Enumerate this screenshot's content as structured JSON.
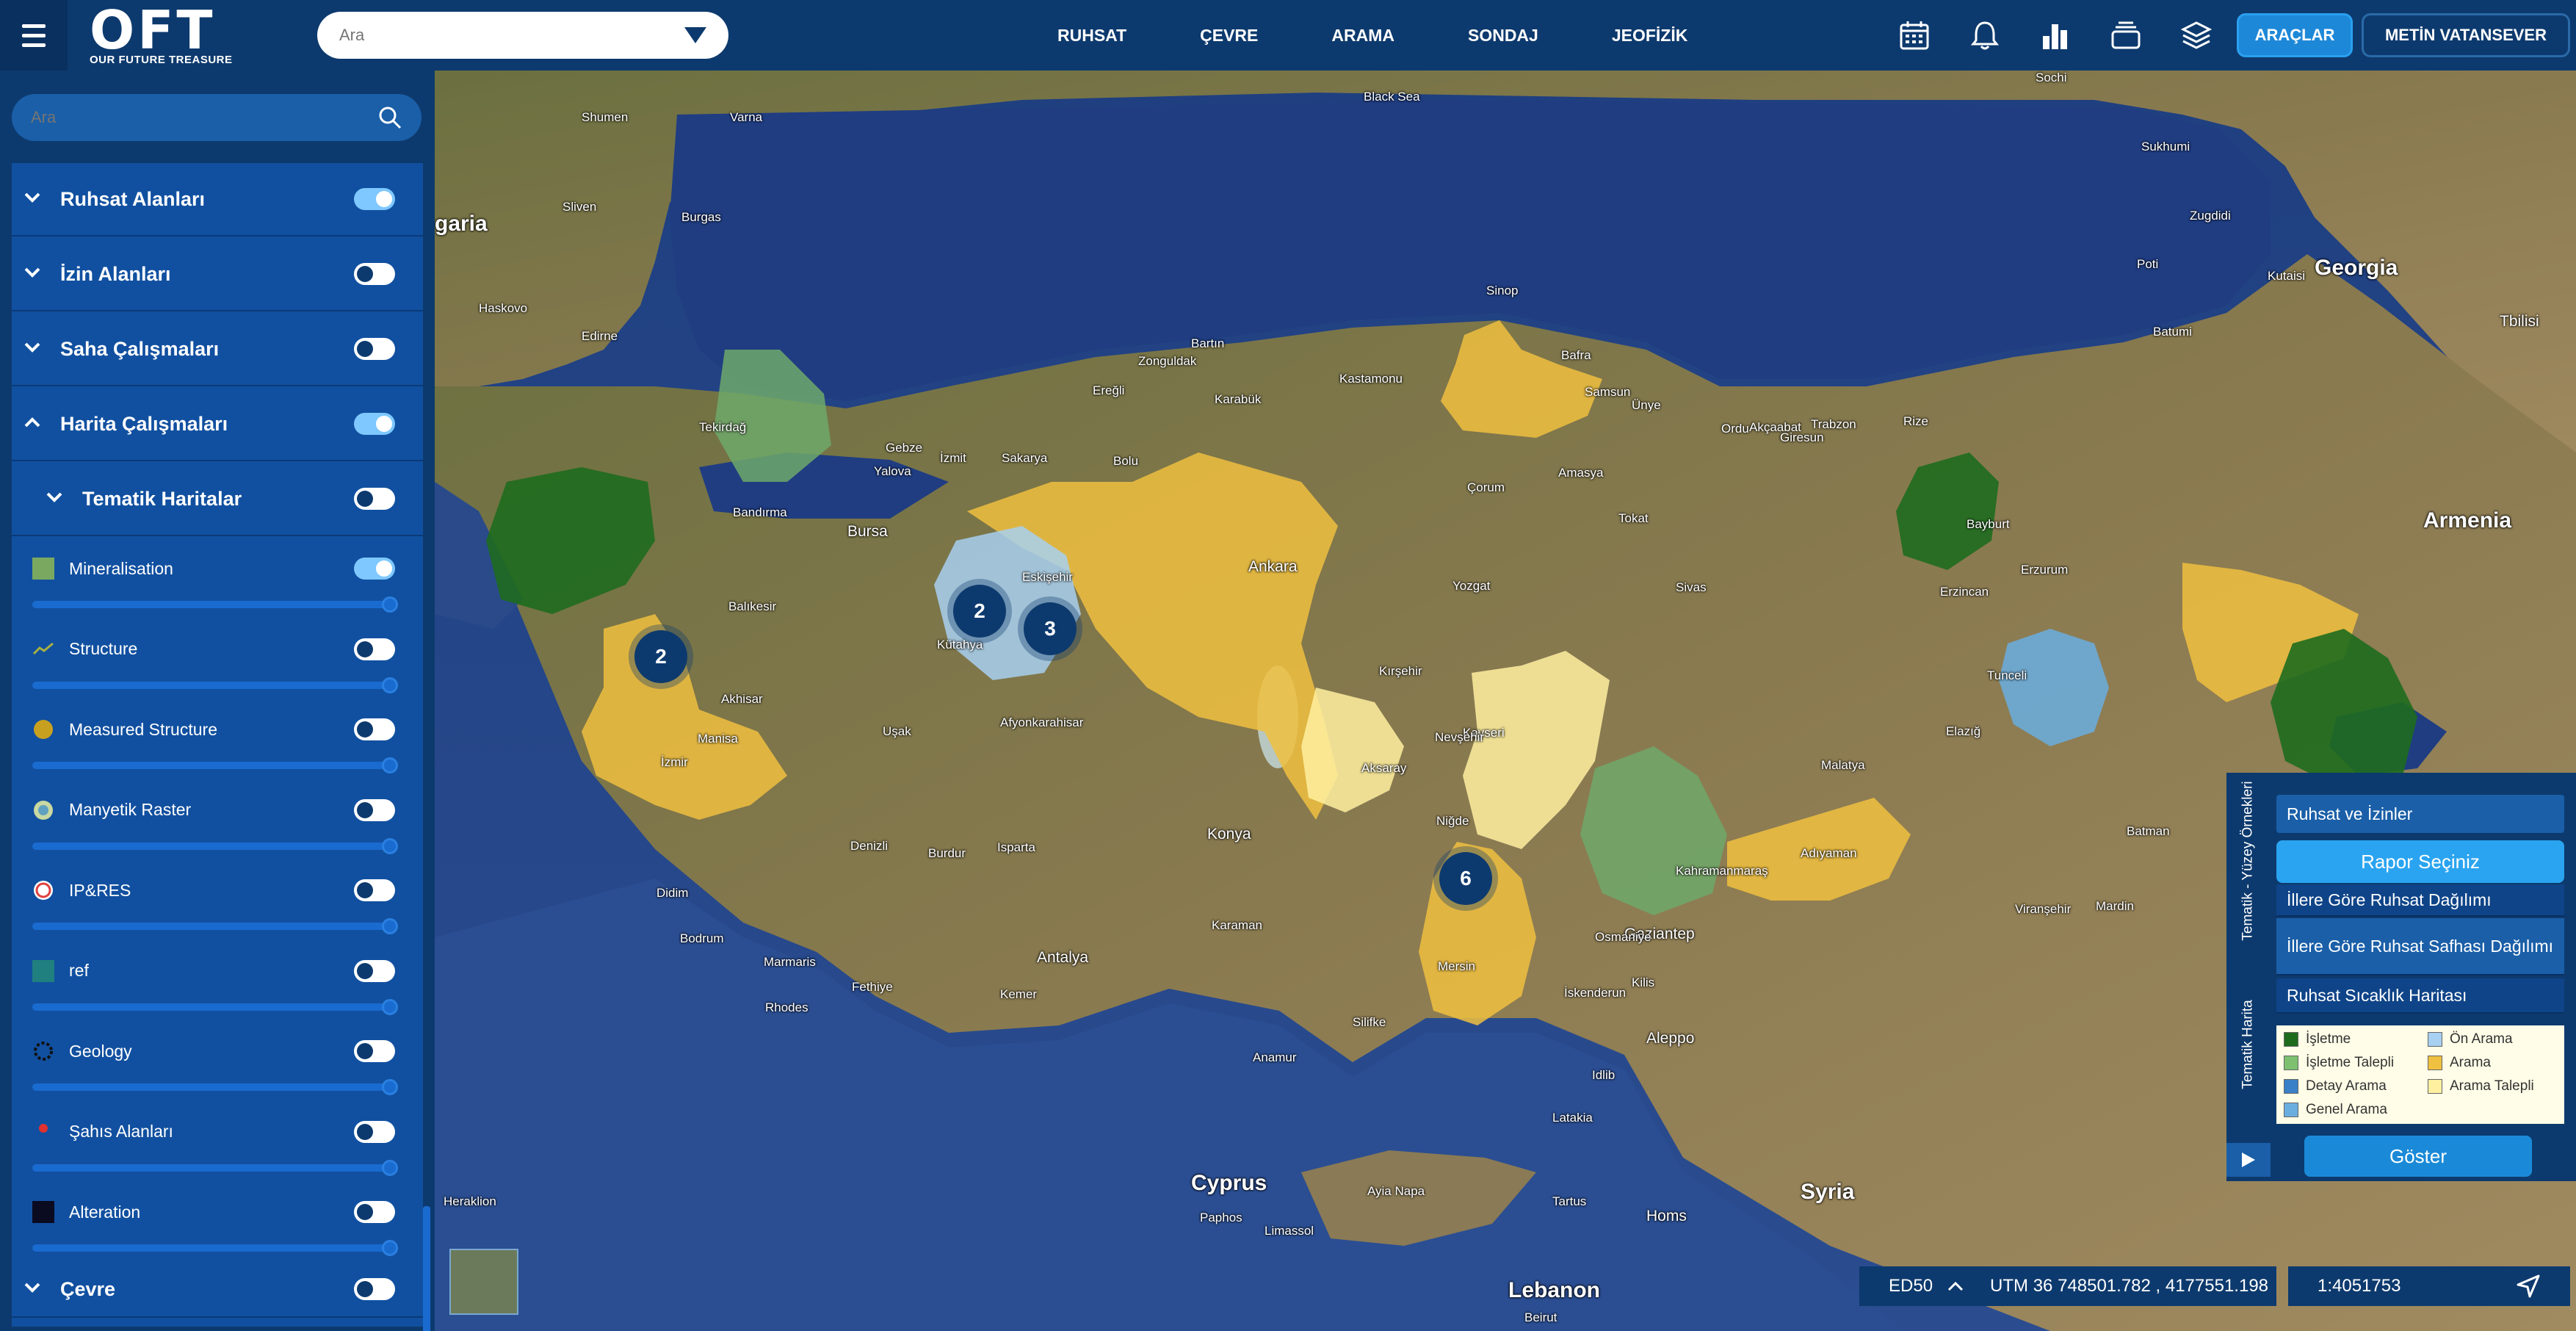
{
  "header": {
    "logo_text": "OFT",
    "logo_subtitle": "OUR FUTURE TREASURE",
    "search_placeholder": "Ara",
    "nav": [
      "RUHSAT",
      "ÇEVRE",
      "ARAMA",
      "SONDAJ",
      "JEOFİZİK"
    ],
    "icons": [
      "calendar-icon",
      "bell-icon",
      "bar-chart-icon",
      "stack-icon",
      "layers-icon"
    ],
    "araclar_label": "ARAÇLAR",
    "user_label": "METİN VATANSEVER"
  },
  "sidebar": {
    "search_placeholder": "Ara",
    "groups": [
      {
        "label": "Ruhsat Alanları",
        "toggle": "on"
      },
      {
        "label": "İzin Alanları",
        "toggle": "off"
      },
      {
        "label": "Saha Çalışmaları",
        "toggle": "off"
      },
      {
        "label": "Harita Çalışmaları",
        "toggle": "on"
      },
      {
        "label": "Tematik Haritalar",
        "toggle": "off"
      },
      {
        "label": "Çevre",
        "toggle": "off"
      }
    ],
    "layers": [
      {
        "label": "Mineralisation",
        "toggle": "on",
        "icon": "mineralisation-icon",
        "color": "#7aa860"
      },
      {
        "label": "Structure",
        "toggle": "off",
        "icon": "structure-line-icon",
        "color": "#a8b040"
      },
      {
        "label": "Measured Structure",
        "toggle": "off",
        "icon": "measured-structure-icon",
        "color": "#c8a020"
      },
      {
        "label": "Manyetik Raster",
        "toggle": "off",
        "icon": "raster-icon",
        "color": "#60a0c0"
      },
      {
        "label": "IP&RES",
        "toggle": "off",
        "icon": "ip-res-icon",
        "color": "#e04040"
      },
      {
        "label": "ref",
        "toggle": "off",
        "icon": "ref-icon",
        "color": "#208080"
      },
      {
        "label": "Geology",
        "toggle": "off",
        "icon": "geology-icon",
        "color": "#111111"
      },
      {
        "label": "Şahıs Alanları",
        "toggle": "off",
        "icon": "pin-icon",
        "color": "#e03030"
      },
      {
        "label": "Alteration",
        "toggle": "off",
        "icon": "alteration-icon",
        "color": "#0a0a20"
      }
    ]
  },
  "map": {
    "labels": [
      {
        "text": "Black Sea",
        "cls": ""
      },
      {
        "text": "Georgia",
        "cls": "big"
      },
      {
        "text": "Armenia",
        "cls": "big"
      },
      {
        "text": "Tbilisi",
        "cls": "mid"
      },
      {
        "text": "Syria",
        "cls": "big"
      },
      {
        "text": "Cyprus",
        "cls": "big"
      },
      {
        "text": "Lebanon",
        "cls": "big"
      },
      {
        "text": "garia",
        "cls": "big"
      },
      {
        "text": "Bursa",
        "cls": "mid"
      },
      {
        "text": "Ankara",
        "cls": "mid"
      },
      {
        "text": "Konya",
        "cls": "mid"
      },
      {
        "text": "Antalya",
        "cls": "mid"
      },
      {
        "text": "Gaziantep",
        "cls": "mid"
      },
      {
        "text": "Aleppo",
        "cls": "mid"
      },
      {
        "text": "Homs",
        "cls": "mid"
      },
      {
        "text": "Samsun",
        "cls": ""
      },
      {
        "text": "Trabzon",
        "cls": ""
      },
      {
        "text": "Erzurum",
        "cls": ""
      },
      {
        "text": "Sivas",
        "cls": ""
      },
      {
        "text": "Kayseri",
        "cls": ""
      },
      {
        "text": "Malatya",
        "cls": ""
      },
      {
        "text": "Elazığ",
        "cls": ""
      },
      {
        "text": "Mardin",
        "cls": ""
      },
      {
        "text": "Batman",
        "cls": ""
      },
      {
        "text": "Zonguldak",
        "cls": ""
      },
      {
        "text": "Karabük",
        "cls": ""
      },
      {
        "text": "Kastamonu",
        "cls": ""
      },
      {
        "text": "Sinop",
        "cls": ""
      },
      {
        "text": "Bolu",
        "cls": ""
      },
      {
        "text": "Çorum",
        "cls": ""
      },
      {
        "text": "Amasya",
        "cls": ""
      },
      {
        "text": "Tokat",
        "cls": ""
      },
      {
        "text": "Ordu",
        "cls": ""
      },
      {
        "text": "Giresun",
        "cls": ""
      },
      {
        "text": "Rize",
        "cls": ""
      },
      {
        "text": "Bayburt",
        "cls": ""
      },
      {
        "text": "Erzincan",
        "cls": ""
      },
      {
        "text": "Tunceli",
        "cls": ""
      },
      {
        "text": "Kırşehir",
        "cls": ""
      },
      {
        "text": "Yozgat",
        "cls": ""
      },
      {
        "text": "Nevşehir",
        "cls": ""
      },
      {
        "text": "Aksaray",
        "cls": ""
      },
      {
        "text": "Niğde",
        "cls": ""
      },
      {
        "text": "Karaman",
        "cls": ""
      },
      {
        "text": "Isparta",
        "cls": ""
      },
      {
        "text": "Burdur",
        "cls": ""
      },
      {
        "text": "Denizli",
        "cls": ""
      },
      {
        "text": "Uşak",
        "cls": ""
      },
      {
        "text": "Kütahya",
        "cls": ""
      },
      {
        "text": "Afyonkarahisar",
        "cls": ""
      },
      {
        "text": "Eskişehir",
        "cls": ""
      },
      {
        "text": "Manisa",
        "cls": ""
      },
      {
        "text": "Balıkesir",
        "cls": ""
      },
      {
        "text": "Bandırma",
        "cls": ""
      },
      {
        "text": "Tekirdağ",
        "cls": ""
      },
      {
        "text": "Gebze",
        "cls": ""
      },
      {
        "text": "İzmit",
        "cls": ""
      },
      {
        "text": "Sakarya",
        "cls": ""
      },
      {
        "text": "Yalova",
        "cls": ""
      },
      {
        "text": "Akhisar",
        "cls": ""
      },
      {
        "text": "Didim",
        "cls": ""
      },
      {
        "text": "Bodrum",
        "cls": ""
      },
      {
        "text": "Marmaris",
        "cls": ""
      },
      {
        "text": "Fethiye",
        "cls": ""
      },
      {
        "text": "Kemer",
        "cls": ""
      },
      {
        "text": "Silifke",
        "cls": ""
      },
      {
        "text": "Anamur",
        "cls": ""
      },
      {
        "text": "Osmaniye",
        "cls": ""
      },
      {
        "text": "İskenderun",
        "cls": ""
      },
      {
        "text": "Kilis",
        "cls": ""
      },
      {
        "text": "Viranşehir",
        "cls": ""
      },
      {
        "text": "Idlib",
        "cls": ""
      },
      {
        "text": "Latakia",
        "cls": ""
      },
      {
        "text": "Tartus",
        "cls": ""
      },
      {
        "text": "Paphos",
        "cls": ""
      },
      {
        "text": "Limassol",
        "cls": ""
      },
      {
        "text": "Ayia Napa",
        "cls": ""
      },
      {
        "text": "Heraklion",
        "cls": ""
      },
      {
        "text": "Rhodes",
        "cls": ""
      },
      {
        "text": "Beirut",
        "cls": ""
      },
      {
        "text": "Varna",
        "cls": ""
      },
      {
        "text": "Burgas",
        "cls": ""
      },
      {
        "text": "Shumen",
        "cls": ""
      },
      {
        "text": "Sliven",
        "cls": ""
      },
      {
        "text": "Haskovo",
        "cls": ""
      },
      {
        "text": "Edirne",
        "cls": ""
      },
      {
        "text": "Kutaisi",
        "cls": ""
      },
      {
        "text": "Sochi",
        "cls": ""
      },
      {
        "text": "Sukhumi",
        "cls": ""
      },
      {
        "text": "Zugdidi",
        "cls": ""
      },
      {
        "text": "Batumi",
        "cls": ""
      },
      {
        "text": "Poti",
        "cls": ""
      },
      {
        "text": "Akçaabat",
        "cls": ""
      },
      {
        "text": "Ünye",
        "cls": ""
      },
      {
        "text": "Bafra",
        "cls": ""
      },
      {
        "text": "Adıyaman",
        "cls": ""
      },
      {
        "text": "Kahramanmaraş",
        "cls": ""
      },
      {
        "text": "Mersin",
        "cls": ""
      },
      {
        "text": "Ereğli",
        "cls": ""
      },
      {
        "text": "Bartın",
        "cls": ""
      },
      {
        "text": "İzmir",
        "cls": ""
      }
    ],
    "clusters": [
      "2",
      "2",
      "3",
      "6"
    ]
  },
  "right_panel": {
    "vtabs": [
      "Tematik - Yüzey Örnekleri",
      "Tematik Harita"
    ],
    "top_item": "Ruhsat ve İzinler",
    "rapor_label": "Rapor Seçiniz",
    "items": [
      "İllere Göre Ruhsat Dağılımı",
      "İllere Göre Ruhsat Safhası Dağılımı",
      "Ruhsat Sıcaklık Haritası"
    ],
    "legend": [
      {
        "label": "İşletme",
        "color": "#1e6b1e"
      },
      {
        "label": "Ön Arama",
        "color": "#a8d0f0"
      },
      {
        "label": "İşletme Talepli",
        "color": "#7cc070"
      },
      {
        "label": "Arama",
        "color": "#f0c040"
      },
      {
        "label": "Detay Arama",
        "color": "#3a80c8"
      },
      {
        "label": "Arama Talepli",
        "color": "#fff0a0"
      },
      {
        "label": "Genel Arama",
        "color": "#6aaee0"
      }
    ],
    "goster_label": "Göster"
  },
  "status_bar": {
    "datum": "ED50",
    "coords": "UTM 36 748501.782 , 4177551.198",
    "scale": "1:4051753"
  },
  "colors": {
    "navy": "#0d3a6e",
    "accent": "#1e88d8",
    "sea": "#2a4a8a",
    "land": "#7a7048"
  }
}
